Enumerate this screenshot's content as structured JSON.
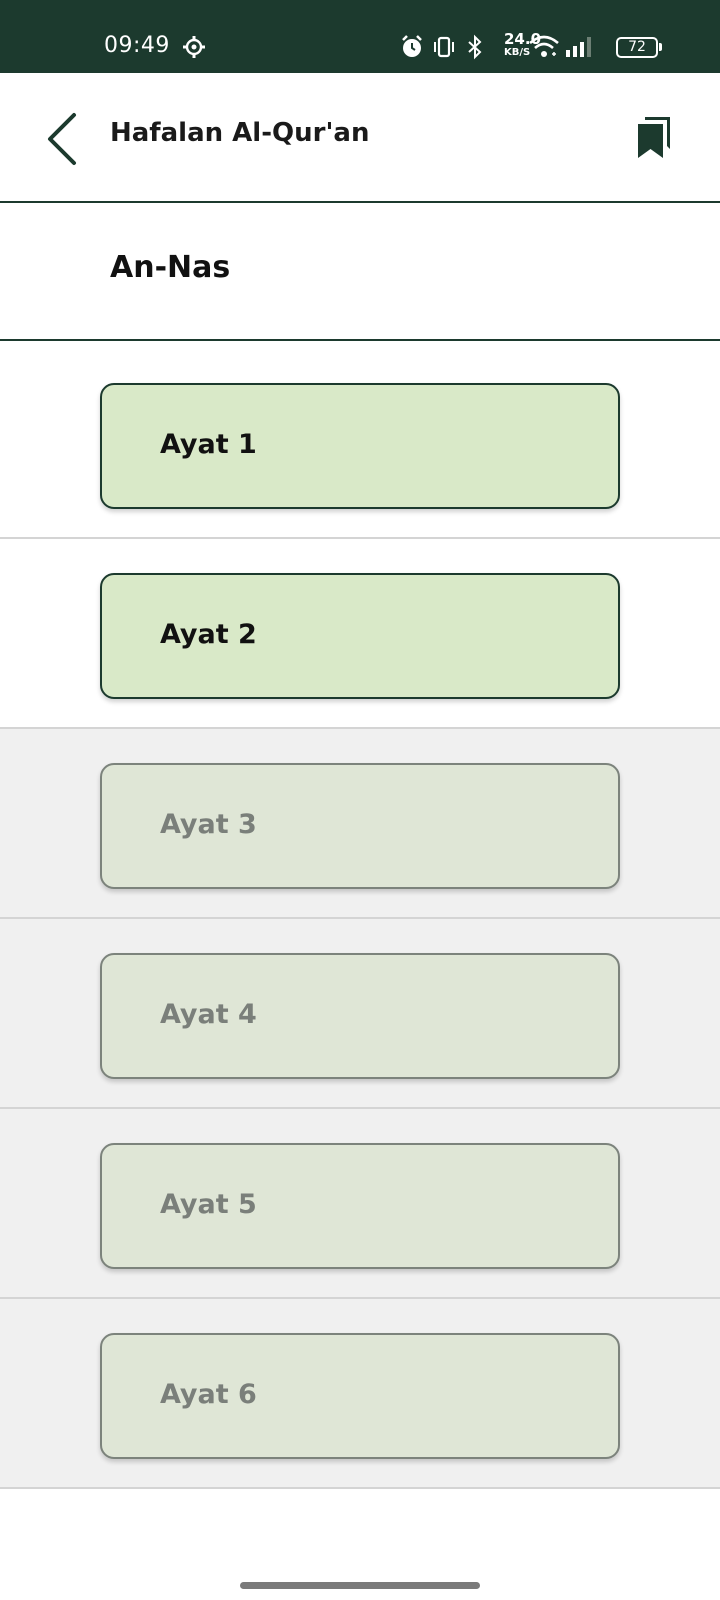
{
  "status_bar": {
    "time": "09:49",
    "network_speed": "24.0",
    "network_speed_unit": "KB/S",
    "battery": "72",
    "icons": [
      "gear-icon",
      "alarm-icon",
      "vibrate-icon",
      "bluetooth-icon",
      "wifi-icon",
      "signal-icon",
      "battery-icon"
    ]
  },
  "app_bar": {
    "title": "Hafalan Al-Qur'an",
    "back_icon": "chevron-left-icon",
    "bookmark_icon": "bookmark-icon"
  },
  "surah": {
    "name": "An-Nas"
  },
  "ayat": [
    {
      "label": "Ayat 1",
      "state": "unlocked"
    },
    {
      "label": "Ayat 2",
      "state": "unlocked"
    },
    {
      "label": "Ayat 3",
      "state": "locked"
    },
    {
      "label": "Ayat 4",
      "state": "locked"
    },
    {
      "label": "Ayat 5",
      "state": "locked"
    },
    {
      "label": "Ayat 6",
      "state": "locked"
    }
  ],
  "colors": {
    "primary": "#1c3a2e",
    "card_active": "#d9e9c8",
    "card_locked": "#dfe6d6",
    "row_locked_bg": "#f0f0f0"
  }
}
